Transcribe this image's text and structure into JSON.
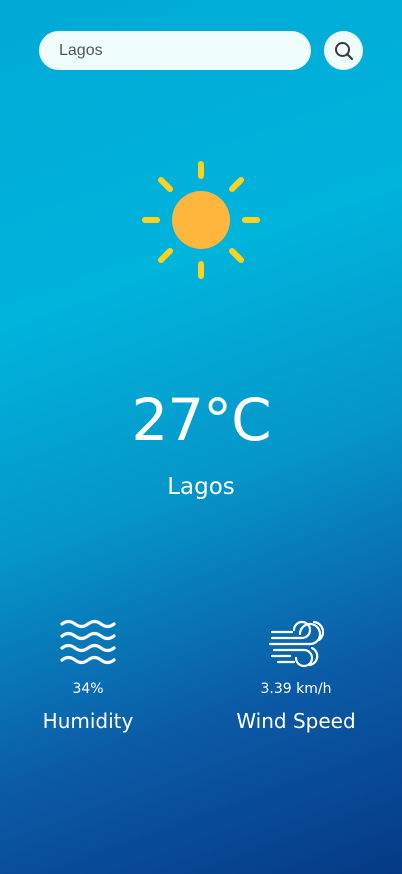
{
  "search": {
    "value": "Lagos",
    "placeholder": "Search",
    "button_icon": "search-icon"
  },
  "weather": {
    "icon": "sun-icon",
    "temperature": "27°C",
    "city": "Lagos"
  },
  "stats": {
    "humidity": {
      "icon": "humidity-waves-icon",
      "value": "34%",
      "label": "Humidity"
    },
    "wind": {
      "icon": "wind-icon",
      "value": "3.39 km/h",
      "label": "Wind Speed"
    }
  },
  "colors": {
    "background_top": "#00b4dc",
    "background_bottom": "#053a86",
    "input_background": "#effdfc",
    "sun_core": "#ffab2e",
    "sun_rays": "#ffd21f"
  }
}
